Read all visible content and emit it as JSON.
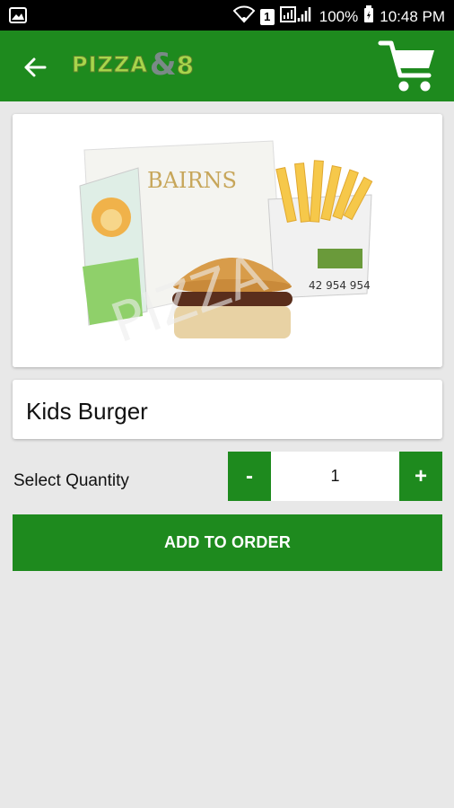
{
  "status_bar": {
    "battery": "100%",
    "time": "10:48 PM",
    "sim_badge": "1",
    "icons": [
      "image-icon",
      "wifi-icon",
      "sim-icon",
      "signal-icon",
      "battery-icon"
    ]
  },
  "app_bar": {
    "logo_text": "PIZZA",
    "logo_amp": "&",
    "logo_num": "8",
    "back_icon": "arrow-left-icon",
    "cart_icon": "shopping-cart-icon",
    "background": "#1e8a1e"
  },
  "product": {
    "name": "Kids Burger",
    "image_alt": "Kids burger meal with fries and box",
    "box_text": "BAIRNS",
    "box_phone": "42 954 954"
  },
  "quantity": {
    "label": "Select Quantity",
    "minus": "-",
    "value": "1",
    "plus": "+"
  },
  "actions": {
    "add_to_order": "ADD TO ORDER"
  },
  "colors": {
    "accent": "#1e8a1e",
    "background": "#e8e8e8"
  }
}
